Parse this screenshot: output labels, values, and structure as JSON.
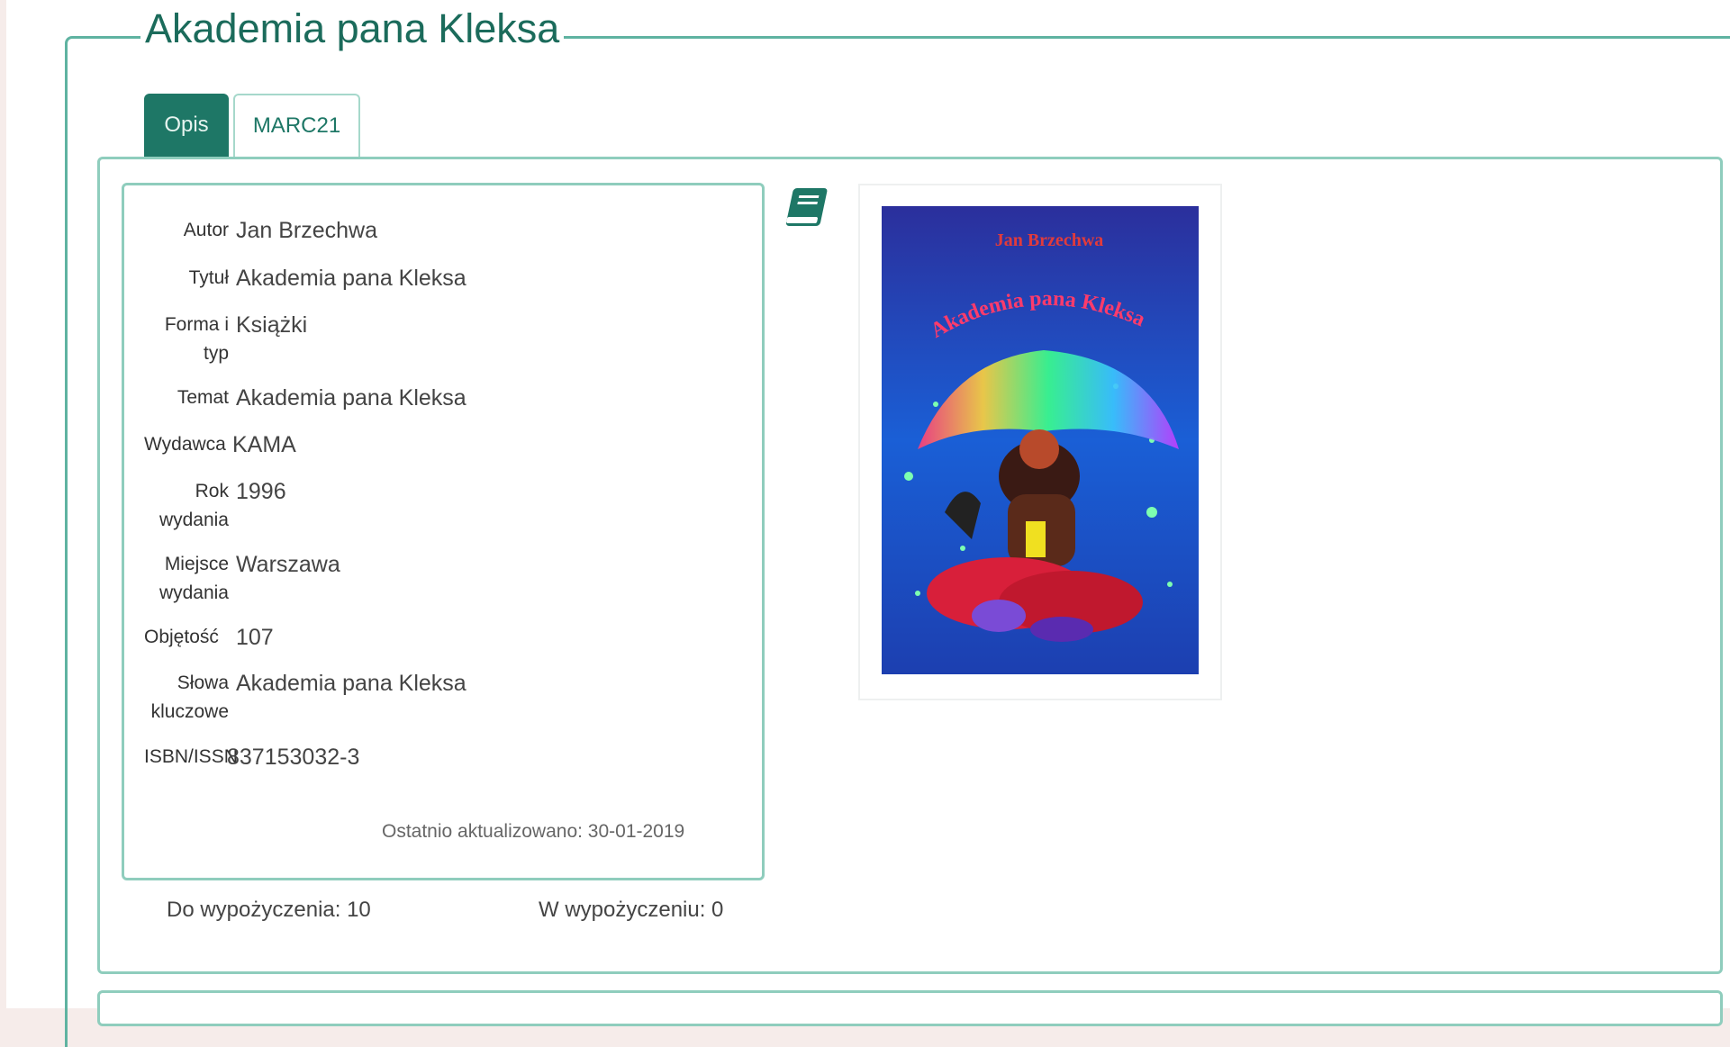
{
  "title": "Akademia pana Kleksa",
  "tabs": [
    {
      "label": "Opis",
      "active": true
    },
    {
      "label": "MARC21",
      "active": false
    }
  ],
  "details": [
    {
      "label": "Autor",
      "value": "Jan Brzechwa"
    },
    {
      "label": "Tytuł",
      "value": "Akademia pana Kleksa"
    },
    {
      "label": "Forma i typ",
      "value": "Książki"
    },
    {
      "label": "Temat",
      "value": "Akademia pana Kleksa"
    },
    {
      "label": "Wydawca",
      "value": "KAMA"
    },
    {
      "label": "Rok wydania",
      "value": "1996"
    },
    {
      "label": "Miejsce wydania",
      "value": "Warszawa"
    },
    {
      "label": "Objętość",
      "value": "107"
    },
    {
      "label": "Słowa kluczowe",
      "value": "Akademia pana Kleksa"
    },
    {
      "label": "ISBN/ISSN",
      "value": "837153032-3"
    }
  ],
  "updated": "Ostatnio aktualizowano: 30-01-2019",
  "availability": {
    "available": "Do wypożyczenia: 10",
    "borrowed": "W wypożyczeniu: 0"
  },
  "cover": {
    "author_text": "Jan Brzechwa",
    "title_text": "Akademia pana Kleksa"
  },
  "colors": {
    "accent": "#1e7766",
    "border": "#8fcdbd",
    "title": "#1b6b5b"
  },
  "icons": {
    "format": "book-icon"
  }
}
